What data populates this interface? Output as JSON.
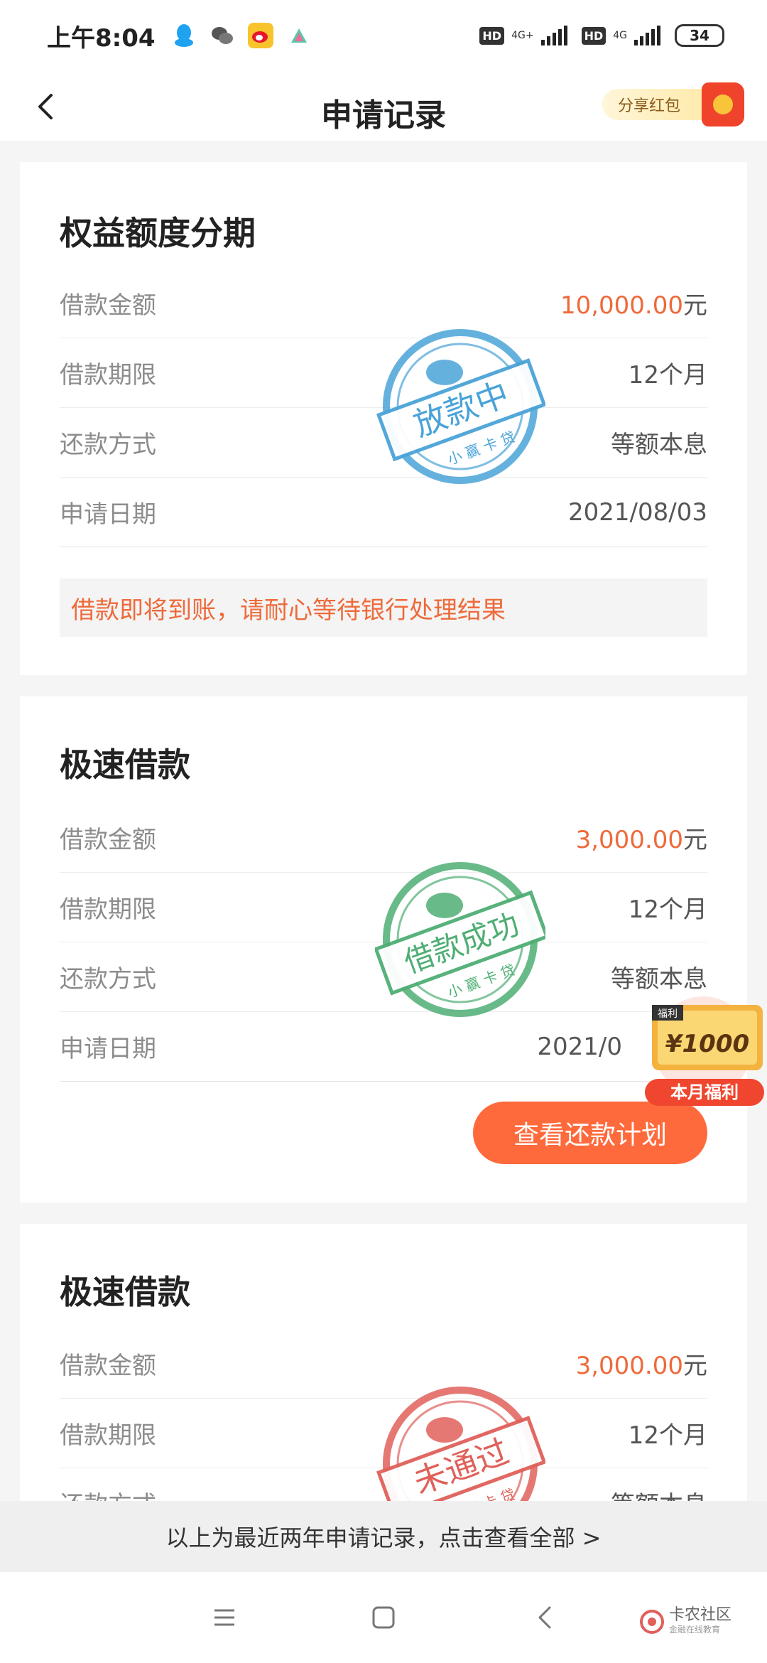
{
  "status": {
    "time": "上午8:04",
    "battery": "34",
    "hd": "HD",
    "net1": "4G+",
    "net2": "4G"
  },
  "nav": {
    "title": "申请记录",
    "share_label": "分享红包"
  },
  "labels": {
    "amount": "借款金额",
    "term": "借款期限",
    "repay": "还款方式",
    "date": "申请日期"
  },
  "cards": [
    {
      "title": "权益额度分期",
      "amount": "10,000.00",
      "unit": "元",
      "term": "12个月",
      "repay": "等额本息",
      "date": "2021/08/03",
      "notice": "借款即将到账，请耐心等待银行处理结果",
      "stamp_text": "放款中",
      "stamp_sub": "小 赢 卡 贷",
      "stamp_color": "#4aa3d8"
    },
    {
      "title": "极速借款",
      "amount": "3,000.00",
      "unit": "元",
      "term": "12个月",
      "repay": "等额本息",
      "date": "2021/0",
      "button": "查看还款计划",
      "stamp_text": "借款成功",
      "stamp_sub": "小 赢 卡 贷",
      "stamp_color": "#4fae74"
    },
    {
      "title": "极速借款",
      "amount": "3,000.00",
      "unit": "元",
      "term": "12个月",
      "repay": "等额本息",
      "stamp_text": "未通过",
      "stamp_sub": "小 赢 卡 贷",
      "stamp_color": "#e0605a"
    }
  ],
  "welfare": {
    "tag": "福利",
    "amount": "¥1000",
    "label": "本月福利"
  },
  "footer": {
    "text": "以上为最近两年申请记录，点击查看全部 >"
  },
  "watermark": {
    "name": "卡农社区",
    "sub": "金融在线教育"
  },
  "colors": {
    "accent": "#ee6a3a",
    "button": "#ff6a3c"
  }
}
